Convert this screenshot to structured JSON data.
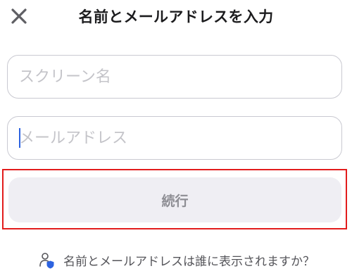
{
  "header": {
    "title": "名前とメールアドレスを入力",
    "close_icon": "close-icon"
  },
  "form": {
    "screen_name": {
      "value": "",
      "placeholder": "スクリーン名"
    },
    "email": {
      "value": "",
      "placeholder": "メールアドレス"
    },
    "continue_label": "続行"
  },
  "footer": {
    "icon": "privacy-person-shield-icon",
    "text": "名前とメールアドレスは誰に表示されますか？"
  },
  "colors": {
    "highlight": "#e21c1c",
    "caret": "#2d63e0",
    "shield": "#2d63e0"
  }
}
